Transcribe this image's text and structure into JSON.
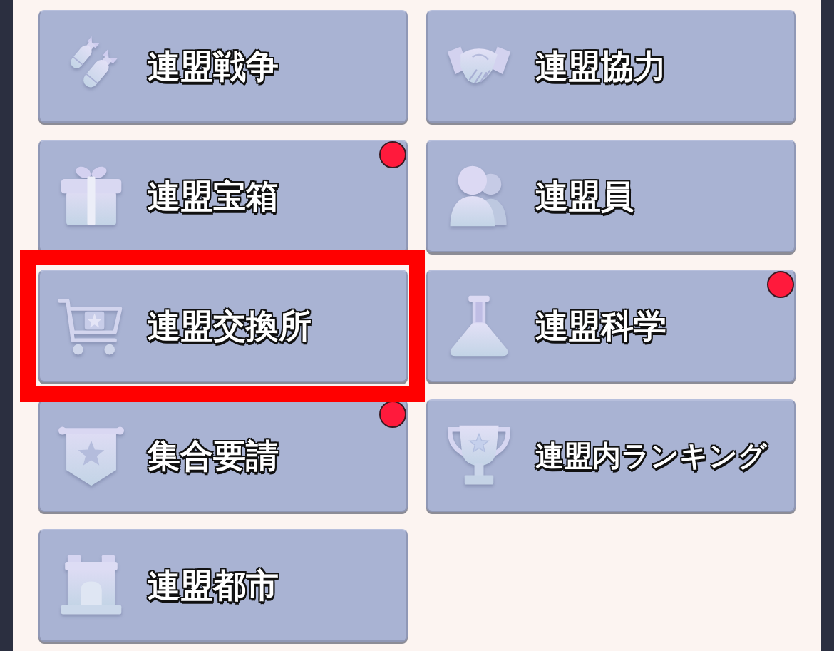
{
  "menu": {
    "items": [
      {
        "label": "連盟戦争",
        "notification": false,
        "highlighted": false
      },
      {
        "label": "連盟協力",
        "notification": false,
        "highlighted": false
      },
      {
        "label": "連盟宝箱",
        "notification": true,
        "highlighted": false
      },
      {
        "label": "連盟員",
        "notification": false,
        "highlighted": false
      },
      {
        "label": "連盟交換所",
        "notification": false,
        "highlighted": true
      },
      {
        "label": "連盟科学",
        "notification": true,
        "highlighted": false
      },
      {
        "label": "集合要請",
        "notification": true,
        "highlighted": false
      },
      {
        "label": "連盟内ランキング",
        "notification": false,
        "highlighted": false
      },
      {
        "label": "連盟都市",
        "notification": false,
        "highlighted": false
      }
    ]
  }
}
